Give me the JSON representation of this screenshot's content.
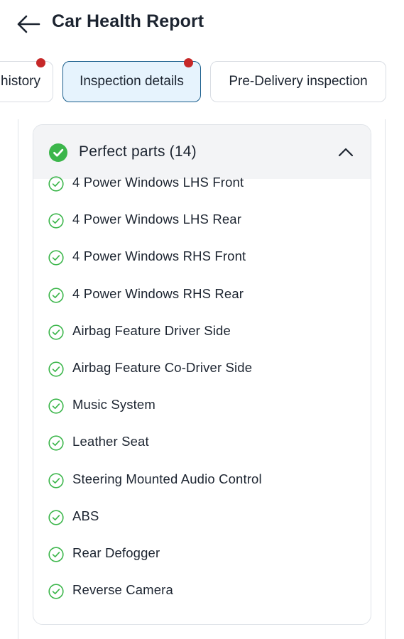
{
  "header": {
    "back_icon": "arrow-left-icon",
    "title": "Car Health Report"
  },
  "tabs": [
    {
      "label": "history",
      "active": false,
      "notification": true
    },
    {
      "label": "Inspection details",
      "active": true,
      "notification": true
    },
    {
      "label": "Pre-Delivery inspection",
      "active": false,
      "notification": false
    }
  ],
  "section": {
    "title": "Perfect parts (14)",
    "status_icon": "check-circle-filled-icon",
    "expanded": true,
    "toggle_icon": "chevron-up-icon",
    "accent_color": "#3cb64b",
    "items": [
      "4 Power Windows LHS Front",
      "4 Power Windows LHS Rear",
      "4 Power Windows RHS Front",
      "4 Power Windows RHS Rear",
      "Airbag Feature Driver Side",
      "Airbag Feature Co-Driver Side",
      "Music System",
      "Leather Seat",
      "Steering Mounted Audio Control",
      "ABS",
      "Rear Defogger",
      "Reverse Camera"
    ]
  }
}
